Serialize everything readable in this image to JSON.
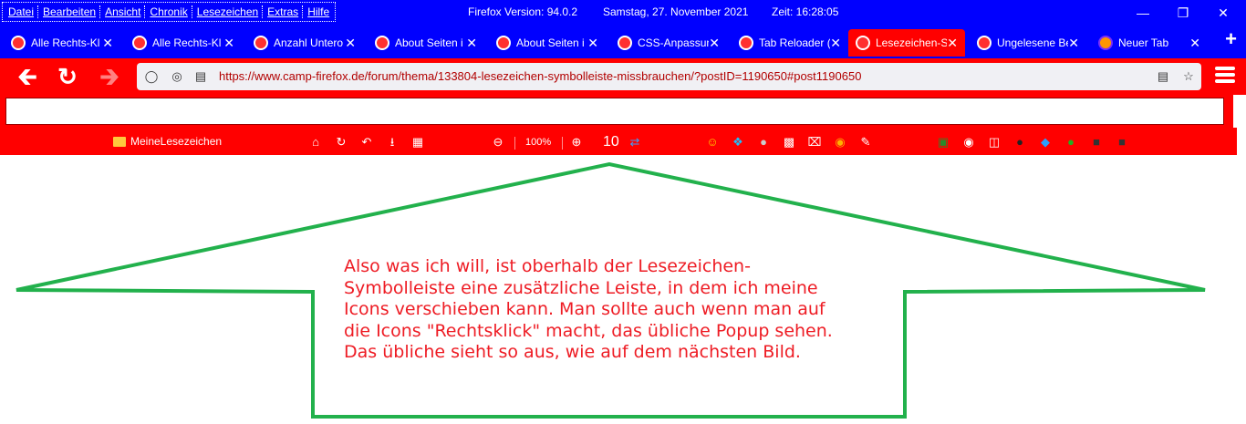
{
  "menubar": {
    "items": [
      "Datei",
      "Bearbeiten",
      "Ansicht",
      "Chronik",
      "Lesezeichen",
      "Extras",
      "Hilfe"
    ]
  },
  "titlebar": {
    "version": "Firefox Version: 94.0.2",
    "date": "Samstag, 27. November 2021",
    "time": "Zeit:  16:28:05"
  },
  "tabs": [
    {
      "label": "Alle Rechts-Kl",
      "selected": false
    },
    {
      "label": "Alle Rechts-Kl",
      "selected": false
    },
    {
      "label": "Anzahl Untero",
      "selected": false
    },
    {
      "label": "About Seiten i",
      "selected": false
    },
    {
      "label": "About Seiten i",
      "selected": false
    },
    {
      "label": "CSS-Anpassun",
      "selected": false
    },
    {
      "label": "Tab Reloader (",
      "selected": false
    },
    {
      "label": "Lesezeichen-S",
      "selected": true
    },
    {
      "label": "Ungelesene Be",
      "selected": false
    },
    {
      "label": "Neuer Tab",
      "selected": false
    }
  ],
  "navbar": {
    "url": "https://www.camp-firefox.de/forum/thema/133804-lesezeichen-symbolleiste-missbrauchen/?postID=1190650#post1190650"
  },
  "bookmarks": {
    "folder_label": "MeineLesezeichen",
    "zoom_level": "100%",
    "count_label": "10"
  },
  "annotation": {
    "lines": [
      "Also was ich will, ist oberhalb der Lesezeichen-",
      "Symbolleiste eine zusätzliche Leiste, in dem ich meine",
      "Icons verschieben kann. Man sollte auch wenn man auf",
      "die Icons \"Rechtsklick\" macht, das übliche Popup sehen.",
      "Das übliche sieht so aus, wie auf dem nächsten Bild."
    ]
  },
  "colors": {
    "titlebar": "#0000ff",
    "toolbar": "#ff0000",
    "arrow": "#22b14c",
    "annotation_text": "#ee1c24"
  }
}
